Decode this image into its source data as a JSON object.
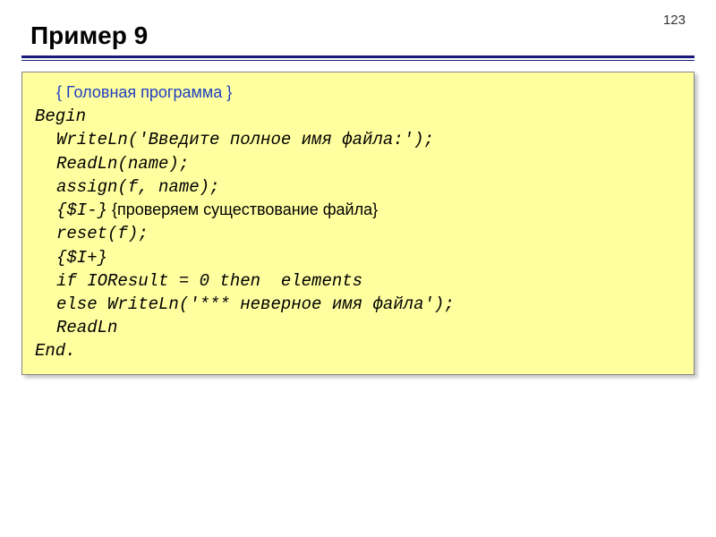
{
  "page_number": "123",
  "title": "Пример 9",
  "code": {
    "comment_header": "{ Головная программа }",
    "l01": "Begin",
    "l02": "WriteLn('Введите полное имя файла:');",
    "l03": "ReadLn(name);",
    "l04": "assign(f, name);",
    "l05a": "{$I-}",
    "l05b": " {проверяем существование файла}",
    "l06": "reset(f);",
    "l07": "{$I+}",
    "l08": "if IOResult = 0 then  elements",
    "l09": "else WriteLn('*** неверное имя файла');",
    "l10": "ReadLn",
    "l11": "End."
  }
}
